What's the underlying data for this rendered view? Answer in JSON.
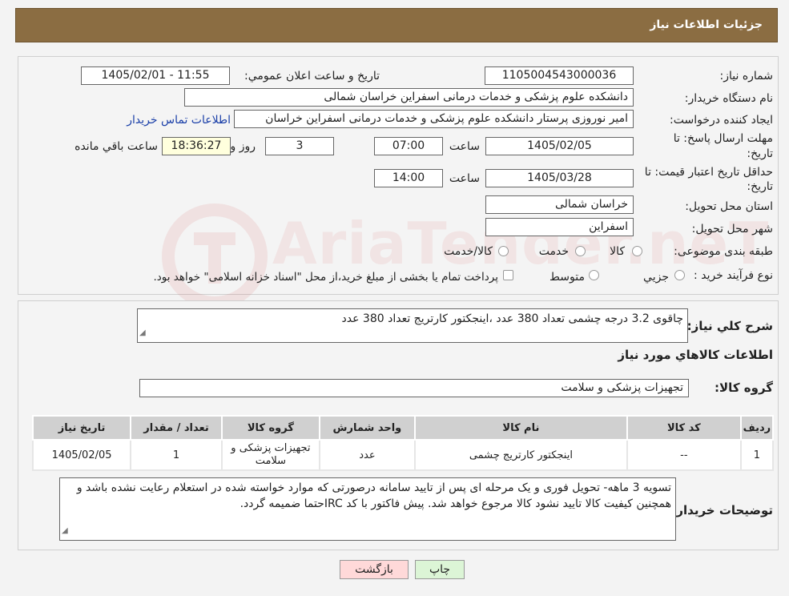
{
  "header": {
    "title": "جزئیات اطلاعات نیاز"
  },
  "form": {
    "need_number_label": "شماره نیاز:",
    "need_number": "1105004543000036",
    "announce_label": "تاريخ و ساعت اعلان عمومي:",
    "announce_value": "1405/02/01 - 11:55",
    "buyer_org_label": "نام دستگاه خريدار:",
    "buyer_org": "دانشکده علوم پزشکی و خدمات درمانی اسفراین خراسان شمالی",
    "creator_label": "ايجاد کننده درخواست:",
    "creator": "امیر  نوروزی  پرستار  دانشکده علوم پزشکی و خدمات درمانی اسفراین خراسان",
    "contact_link": "اطلاعات تماس خريدار",
    "deadline_label_1": "مهلت ارسال پاسخ: تا",
    "deadline_label_2": "تاریخ:",
    "deadline_date": "1405/02/05",
    "time_label": "ساعت",
    "deadline_time": "07:00",
    "days_value": "3",
    "days_label": "روز و",
    "remaining_time": "18:36:27",
    "remaining_label": "ساعت باقي مانده",
    "validity_label_1": "حداقل تاريخ اعتبار قيمت: تا",
    "validity_label_2": "تاریخ:",
    "validity_date": "1405/03/28",
    "validity_time": "14:00",
    "province_label": "استان محل تحويل:",
    "province": "خراسان شمالی",
    "city_label": "شهر محل تحويل:",
    "city": "اسفراین",
    "category_label": "طبقه بندی موضوعی:",
    "category_options": [
      "کالا",
      "خدمت",
      "کالا/خدمت"
    ],
    "process_label": "نوع فرآيند خريد :",
    "process_options": [
      "جزيي",
      "متوسط"
    ],
    "process_note": "پرداخت تمام يا بخشی از مبلغ خريد،از محل \"اسناد خزانه اسلامی\" خواهد بود."
  },
  "need": {
    "summary_label": "شرح کلي نياز:",
    "summary": "چاقوی 3.2 درجه چشمی  تعداد 380 عدد ،اینجکتور کارتریج تعداد 380 عدد",
    "goods_info_title": "اطلاعات کالاهاي مورد نياز",
    "goods_group_label": "گروه کالا:",
    "goods_group": "تجهیزات پزشکی و سلامت"
  },
  "table": {
    "columns": [
      "رديف",
      "کد کالا",
      "نام کالا",
      "واحد شمارش",
      "گروه کالا",
      "تعداد / مقدار",
      "تاريخ نياز"
    ],
    "rows": [
      [
        "1",
        "--",
        "اینجکتور کارتریج چشمی",
        "عدد",
        "تجهیزات پزشکی و سلامت",
        "1",
        "1405/02/05"
      ]
    ]
  },
  "notes": {
    "label": "توضيحات خريدار:",
    "text": "تسویه 3 ماهه- تحویل فوری و یک مرحله ای پس از تایید سامانه درصورتی که موارد خواسته شده در استعلام رعایت نشده باشد و همچنین کیفیت کالا تایید نشود کالا مرجوع خواهد شد. پیش فاکتور با کد IRCحتما ضمیمه گردد."
  },
  "buttons": {
    "print": "چاپ",
    "back": "بازگشت"
  },
  "watermark": {
    "text": "AriaTender.neT"
  },
  "colors": {
    "header_bg": "#8b6d42",
    "link": "#1a3fa8",
    "back_bg": "#ffd9d9",
    "print_bg": "#dcf5d6"
  }
}
